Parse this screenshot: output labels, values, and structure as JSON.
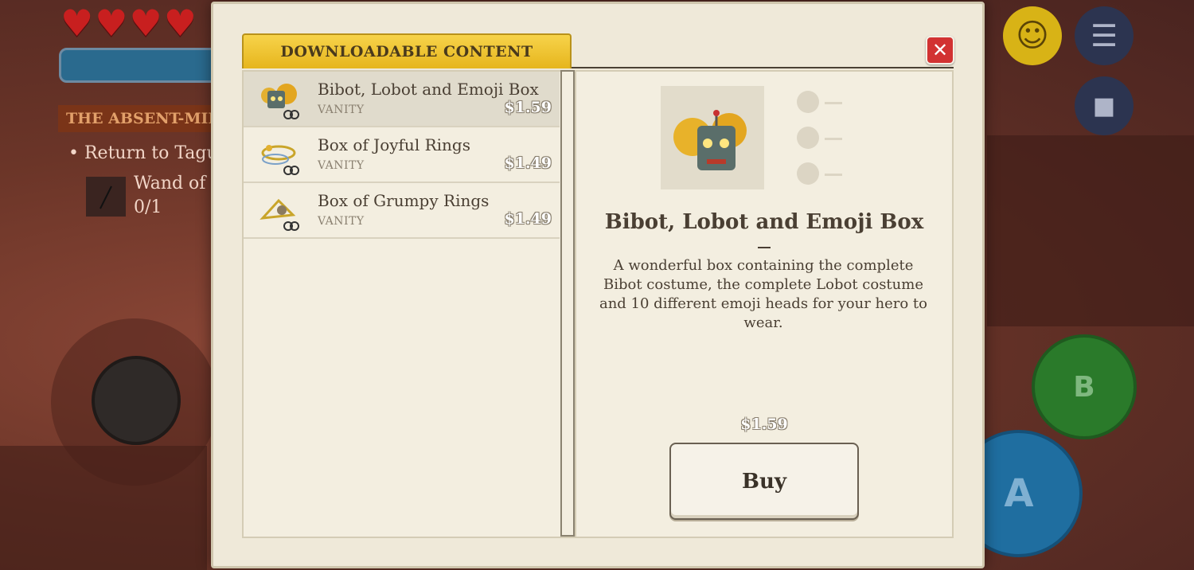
{
  "hud": {
    "quest_title": "THE ABSENT-MINI",
    "quest_objective": "Return to Tagus",
    "quest_item_name": "Wand of I",
    "quest_item_count": "0/1",
    "b_button": "B",
    "a_button": "A"
  },
  "dialog": {
    "tab_title": "DOWNLOADABLE CONTENT",
    "close_label": "✕",
    "items": [
      {
        "name": "Bibot, Lobot and Emoji Box",
        "category": "VANITY",
        "price": "$1.59",
        "selected": true
      },
      {
        "name": "Box of Joyful Rings",
        "category": "VANITY",
        "price": "$1.49",
        "selected": false
      },
      {
        "name": "Box of Grumpy Rings",
        "category": "VANITY",
        "price": "$1.49",
        "selected": false
      }
    ],
    "detail": {
      "title": "Bibot, Lobot and Emoji Box",
      "description": "A wonderful box containing the complete Bibot costume, the complete Lobot costume and 10 different emoji heads for your hero to wear.",
      "price": "$1.59",
      "buy_label": "Buy"
    }
  },
  "colors": {
    "tab_gold": "#f7d34a",
    "close_red": "#d23232",
    "parchment": "#efe9d9"
  }
}
